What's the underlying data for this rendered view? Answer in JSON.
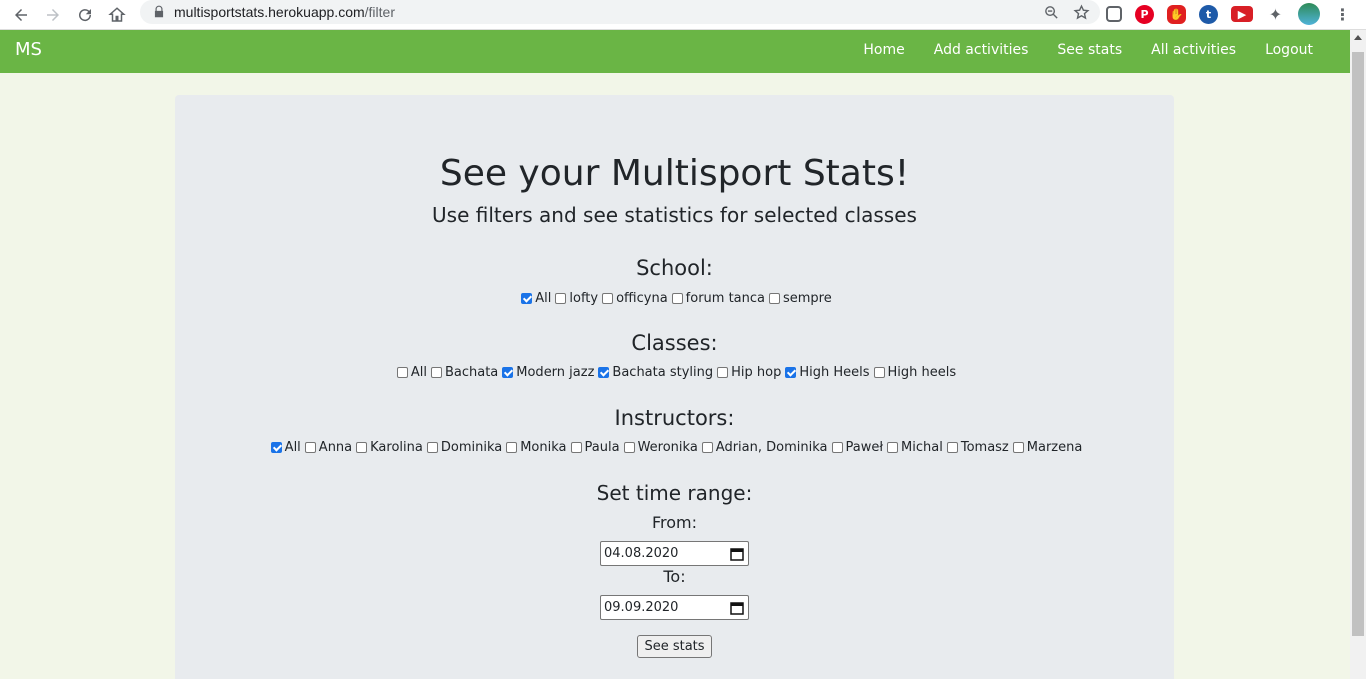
{
  "browser": {
    "url_host": "multisportstats.herokuapp.com",
    "url_path": "/filter"
  },
  "navbar": {
    "brand": "MS",
    "links": [
      "Home",
      "Add activities",
      "See stats",
      "All activities",
      "Logout"
    ]
  },
  "page": {
    "title": "See your Multisport Stats!",
    "subtitle": "Use filters and see statistics for selected classes"
  },
  "school": {
    "heading": "School:",
    "options": [
      {
        "label": "All",
        "checked": true
      },
      {
        "label": "lofty",
        "checked": false
      },
      {
        "label": "officyna",
        "checked": false
      },
      {
        "label": "forum tanca",
        "checked": false
      },
      {
        "label": "sempre",
        "checked": false
      }
    ]
  },
  "classes": {
    "heading": "Classes:",
    "options": [
      {
        "label": "All",
        "checked": false
      },
      {
        "label": "Bachata",
        "checked": false
      },
      {
        "label": "Modern jazz",
        "checked": true
      },
      {
        "label": "Bachata styling",
        "checked": true
      },
      {
        "label": "Hip hop",
        "checked": false
      },
      {
        "label": "High Heels",
        "checked": true
      },
      {
        "label": "High heels",
        "checked": false
      }
    ]
  },
  "instructors": {
    "heading": "Instructors:",
    "options": [
      {
        "label": "All",
        "checked": true
      },
      {
        "label": "Anna",
        "checked": false
      },
      {
        "label": "Karolina",
        "checked": false
      },
      {
        "label": "Dominika",
        "checked": false
      },
      {
        "label": "Monika",
        "checked": false
      },
      {
        "label": "Paula",
        "checked": false
      },
      {
        "label": "Weronika",
        "checked": false
      },
      {
        "label": "Adrian, Dominika",
        "checked": false
      },
      {
        "label": "Paweł",
        "checked": false
      },
      {
        "label": "Michal",
        "checked": false
      },
      {
        "label": "Tomasz",
        "checked": false
      },
      {
        "label": "Marzena",
        "checked": false
      }
    ]
  },
  "time_range": {
    "heading": "Set time range:",
    "from_label": "From:",
    "from_value": "04.08.2020",
    "to_label": "To:",
    "to_value": "09.09.2020"
  },
  "submit_label": "See stats",
  "colors": {
    "navbar": "#6ab545",
    "page_bg": "#f2f6e8",
    "card_bg": "#e8ebee",
    "checkbox_checked": "#1a73e8"
  }
}
